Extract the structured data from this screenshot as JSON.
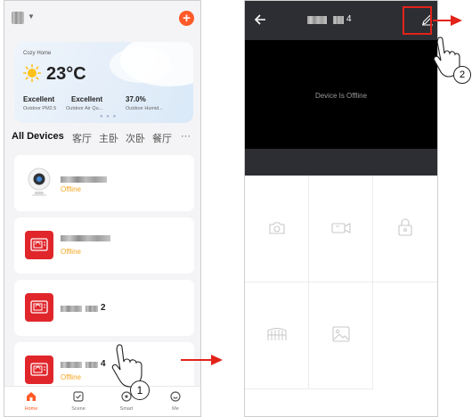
{
  "left": {
    "weather": {
      "home_name": "Cozy Home",
      "temperature": "23°C",
      "pm25_value": "Excellent",
      "pm25_label": "Outdoor PM2.5",
      "air_value": "Excellent",
      "air_label": "Outdoor Air Qu...",
      "humidity_value": "37.0%",
      "humidity_label": "Outdoor Humid..."
    },
    "tabs": [
      "All Devices",
      "客厅",
      "主卧",
      "次卧",
      "餐厅",
      "···"
    ],
    "devices": [
      {
        "suffix": "",
        "status": "Offline"
      },
      {
        "suffix": "",
        "status": "Offline"
      },
      {
        "suffix": "2",
        "status": ""
      },
      {
        "suffix": "4",
        "status": "Offline"
      }
    ],
    "nav": [
      "Home",
      "Scene",
      "Smart",
      "Me"
    ]
  },
  "right": {
    "title_suffix": "4",
    "video_message": "Device Is Offline"
  },
  "callouts": [
    "1",
    "2"
  ],
  "colors": {
    "accent": "#ff5a28",
    "offline": "#f5a623",
    "annotation": "#e2231a"
  }
}
